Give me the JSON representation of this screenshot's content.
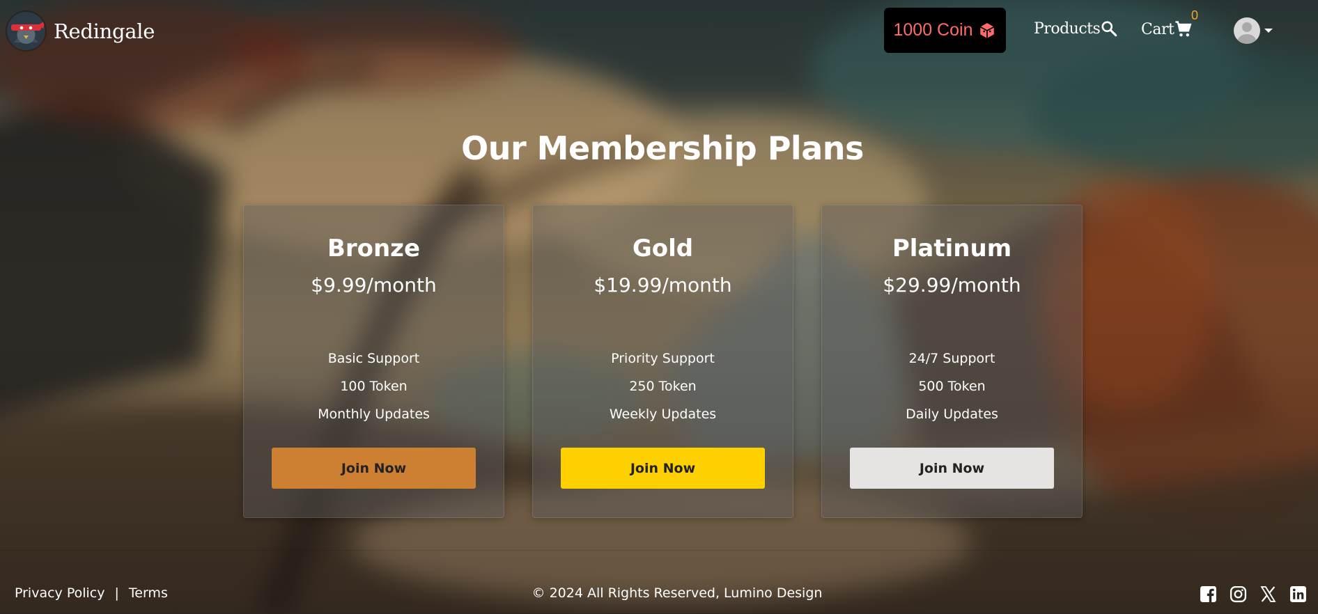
{
  "header": {
    "brand": "Redingale",
    "coin_label": "1000 Coin",
    "nav_products": "Products",
    "nav_cart": "Cart",
    "cart_count": "0",
    "coin_color": "#ff6b6b",
    "cart_badge_color": "#f5a623"
  },
  "main": {
    "title": "Our Membership Plans",
    "plans": [
      {
        "name": "Bronze",
        "price": "$9.99/month",
        "features": [
          "Basic Support",
          "100 Token",
          "Monthly Updates"
        ],
        "button_label": "Join Now",
        "button_color": "#cd7f32"
      },
      {
        "name": "Gold",
        "price": "$19.99/month",
        "features": [
          "Priority Support",
          "250 Token",
          "Weekly Updates"
        ],
        "button_label": "Join Now",
        "button_color": "#ffd000"
      },
      {
        "name": "Platinum",
        "price": "$29.99/month",
        "features": [
          "24/7 Support",
          "500 Token",
          "Daily Updates"
        ],
        "button_label": "Join Now",
        "button_color": "#e5e4e2"
      }
    ]
  },
  "footer": {
    "privacy": "Privacy Policy",
    "separator": "|",
    "terms": "Terms",
    "copyright": "© 2024 All Rights Reserved, Lumino Design",
    "social_icons": [
      "facebook-icon",
      "instagram-icon",
      "x-icon",
      "linkedin-icon"
    ]
  }
}
